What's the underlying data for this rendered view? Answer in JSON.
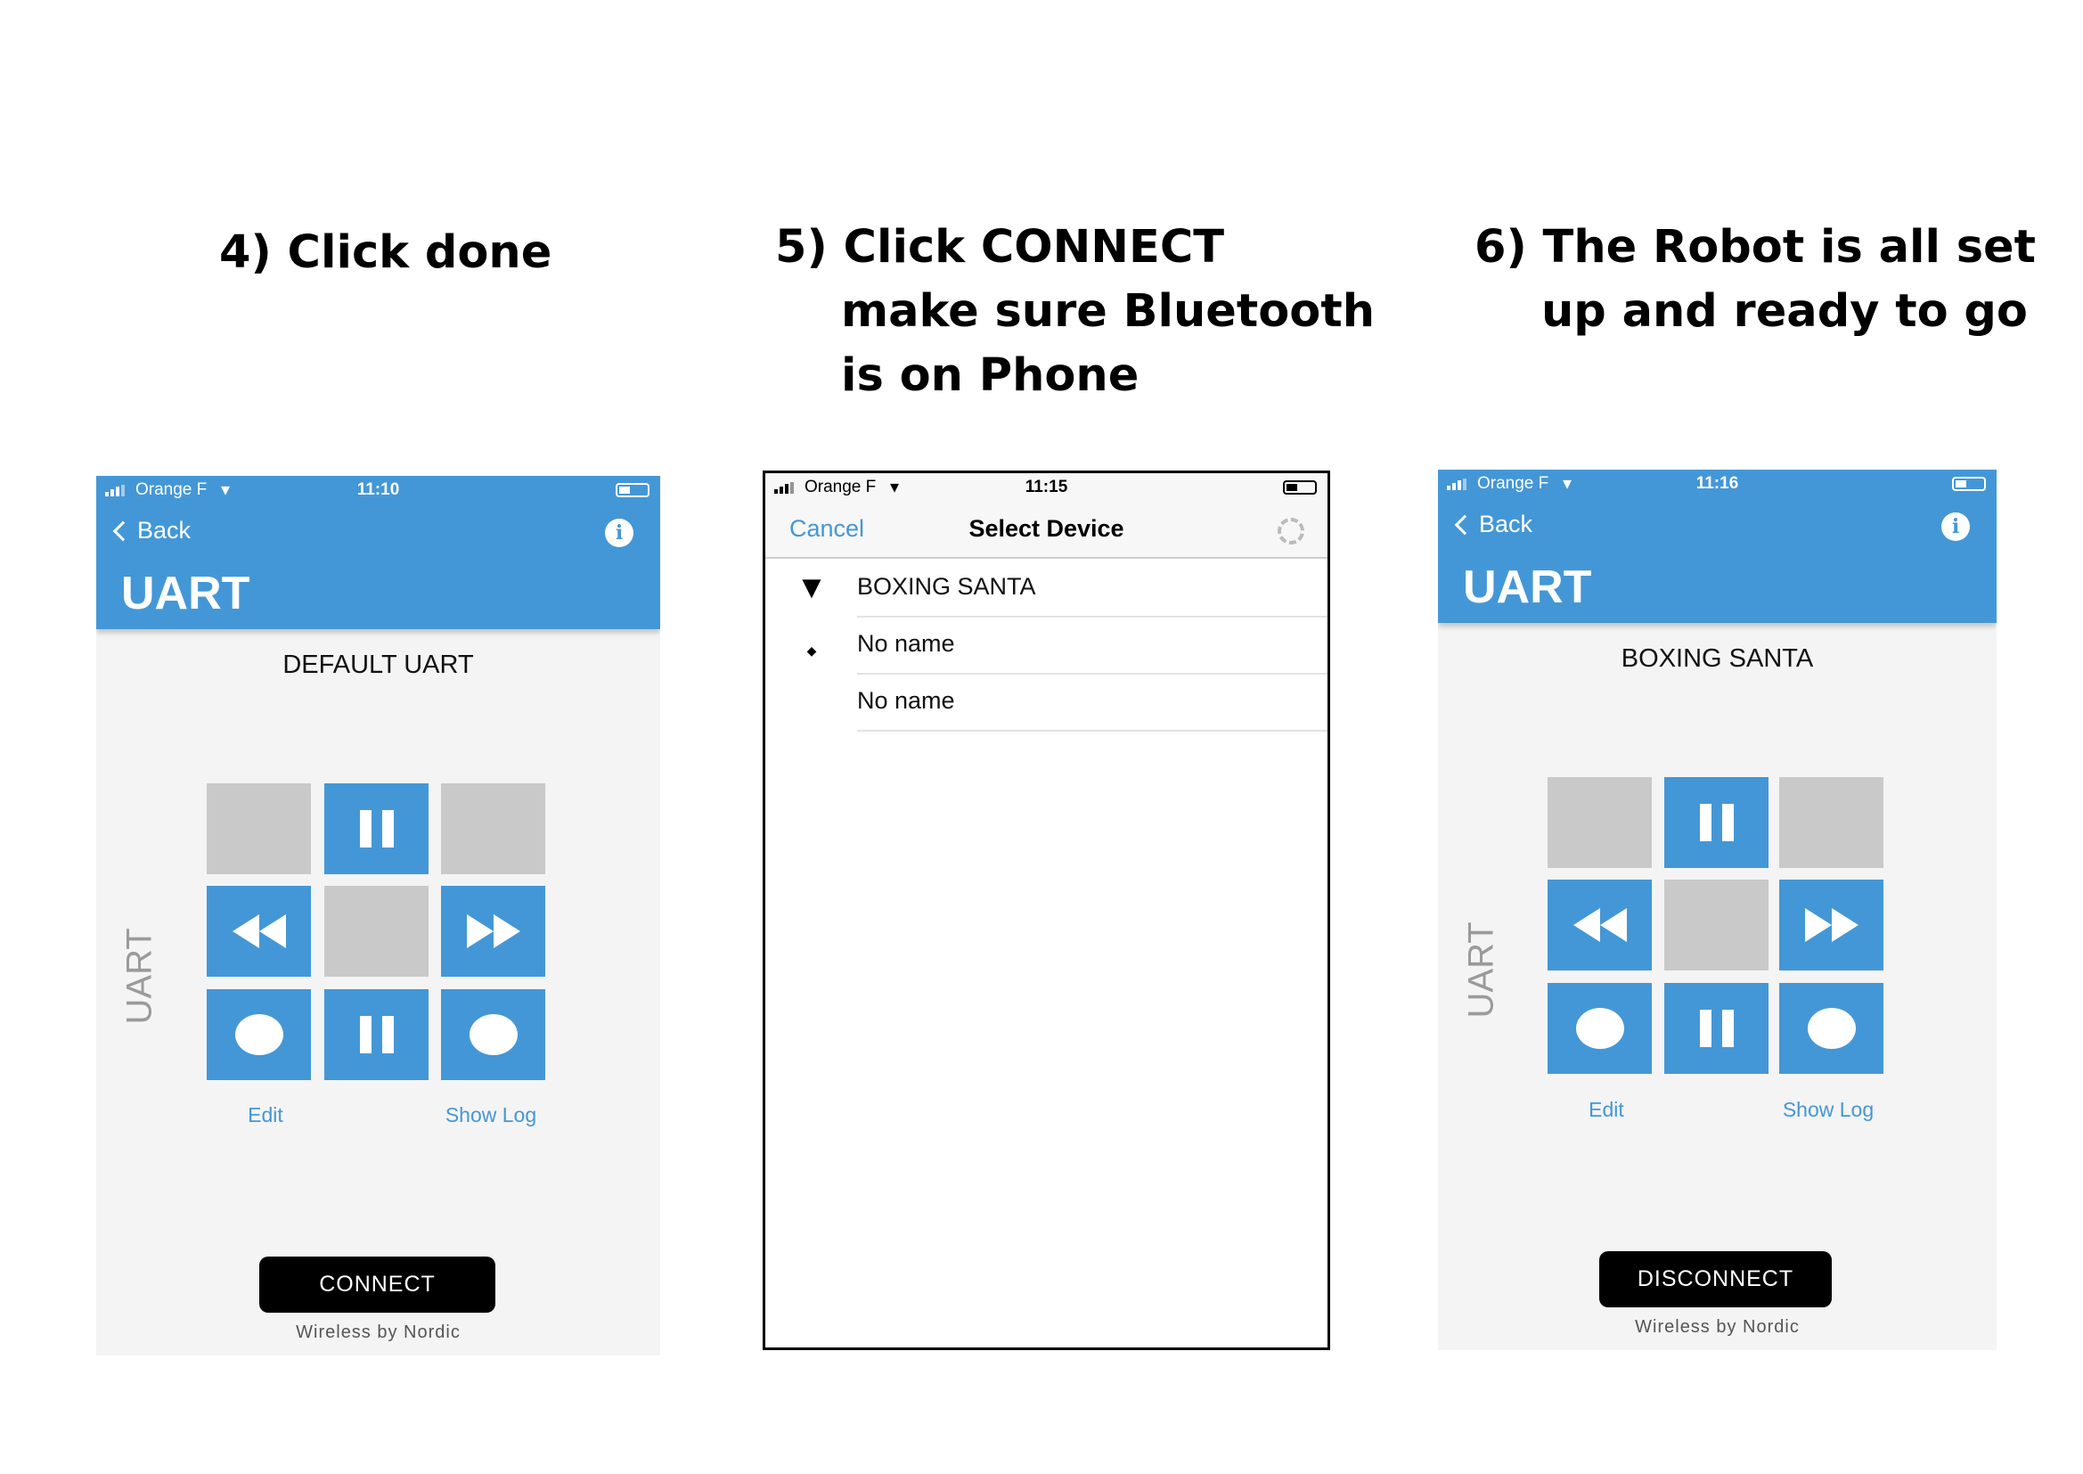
{
  "steps": {
    "step4": {
      "line1": "4) Click done"
    },
    "step5": {
      "line1": "5)  Click CONNECT",
      "line2": "make sure Bluetooth",
      "line3": "is on Phone"
    },
    "step6": {
      "line1": "6) The Robot is all set",
      "line2": "up and ready to go"
    }
  },
  "panel1": {
    "status": {
      "carrier": "Orange F",
      "time": "11:10"
    },
    "back_label": "Back",
    "title": "UART",
    "device_name": "DEFAULT UART",
    "side_label": "UART",
    "edit_label": "Edit",
    "show_log_label": "Show Log",
    "action_label": "CONNECT",
    "footer": "Wireless by Nordic"
  },
  "panel2": {
    "status": {
      "carrier": "Orange F",
      "time": "11:15"
    },
    "cancel_label": "Cancel",
    "title": "Select Device",
    "devices": [
      {
        "name": "BOXING SANTA",
        "signal": "strong"
      },
      {
        "name": "No name",
        "signal": "weak"
      },
      {
        "name": "No name",
        "signal": "none"
      }
    ]
  },
  "panel3": {
    "status": {
      "carrier": "Orange F",
      "time": "11:16"
    },
    "back_label": "Back",
    "title": "UART",
    "device_name": "BOXING SANTA",
    "side_label": "UART",
    "edit_label": "Edit",
    "show_log_label": "Show Log",
    "action_label": "DISCONNECT",
    "footer": "Wireless by Nordic"
  },
  "colors": {
    "header_blue": "#4497d6",
    "button_gray": "#c9c9c9",
    "background": "#f4f4f4"
  },
  "grid_icons": [
    "empty",
    "pause",
    "empty",
    "rewind",
    "empty",
    "fast-forward",
    "record",
    "pause",
    "record"
  ]
}
